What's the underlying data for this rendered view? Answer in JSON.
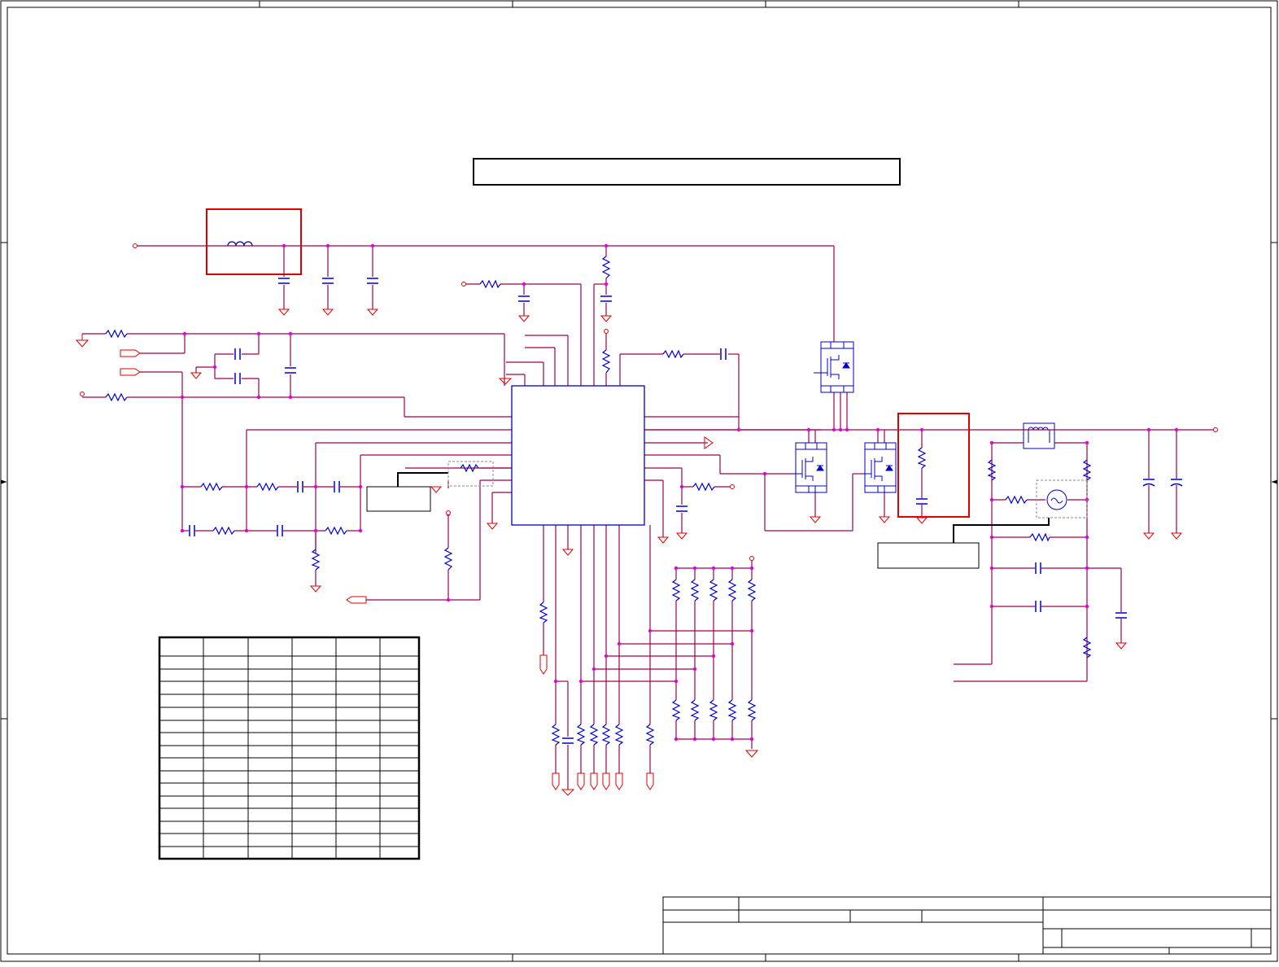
{
  "diagram": {
    "kind": "schematic",
    "title_banner": "",
    "labels": [],
    "pinout_table": {
      "rows": 16,
      "cols": 6,
      "cells": []
    },
    "title_block": {
      "fields": []
    },
    "colors": {
      "wire": "#a0004a",
      "net_node": "#e000e0",
      "component": "#0000cc",
      "ground": "#e00000",
      "highlight": "#e00000",
      "frame": "#000000",
      "dashed": "#888888"
    }
  }
}
